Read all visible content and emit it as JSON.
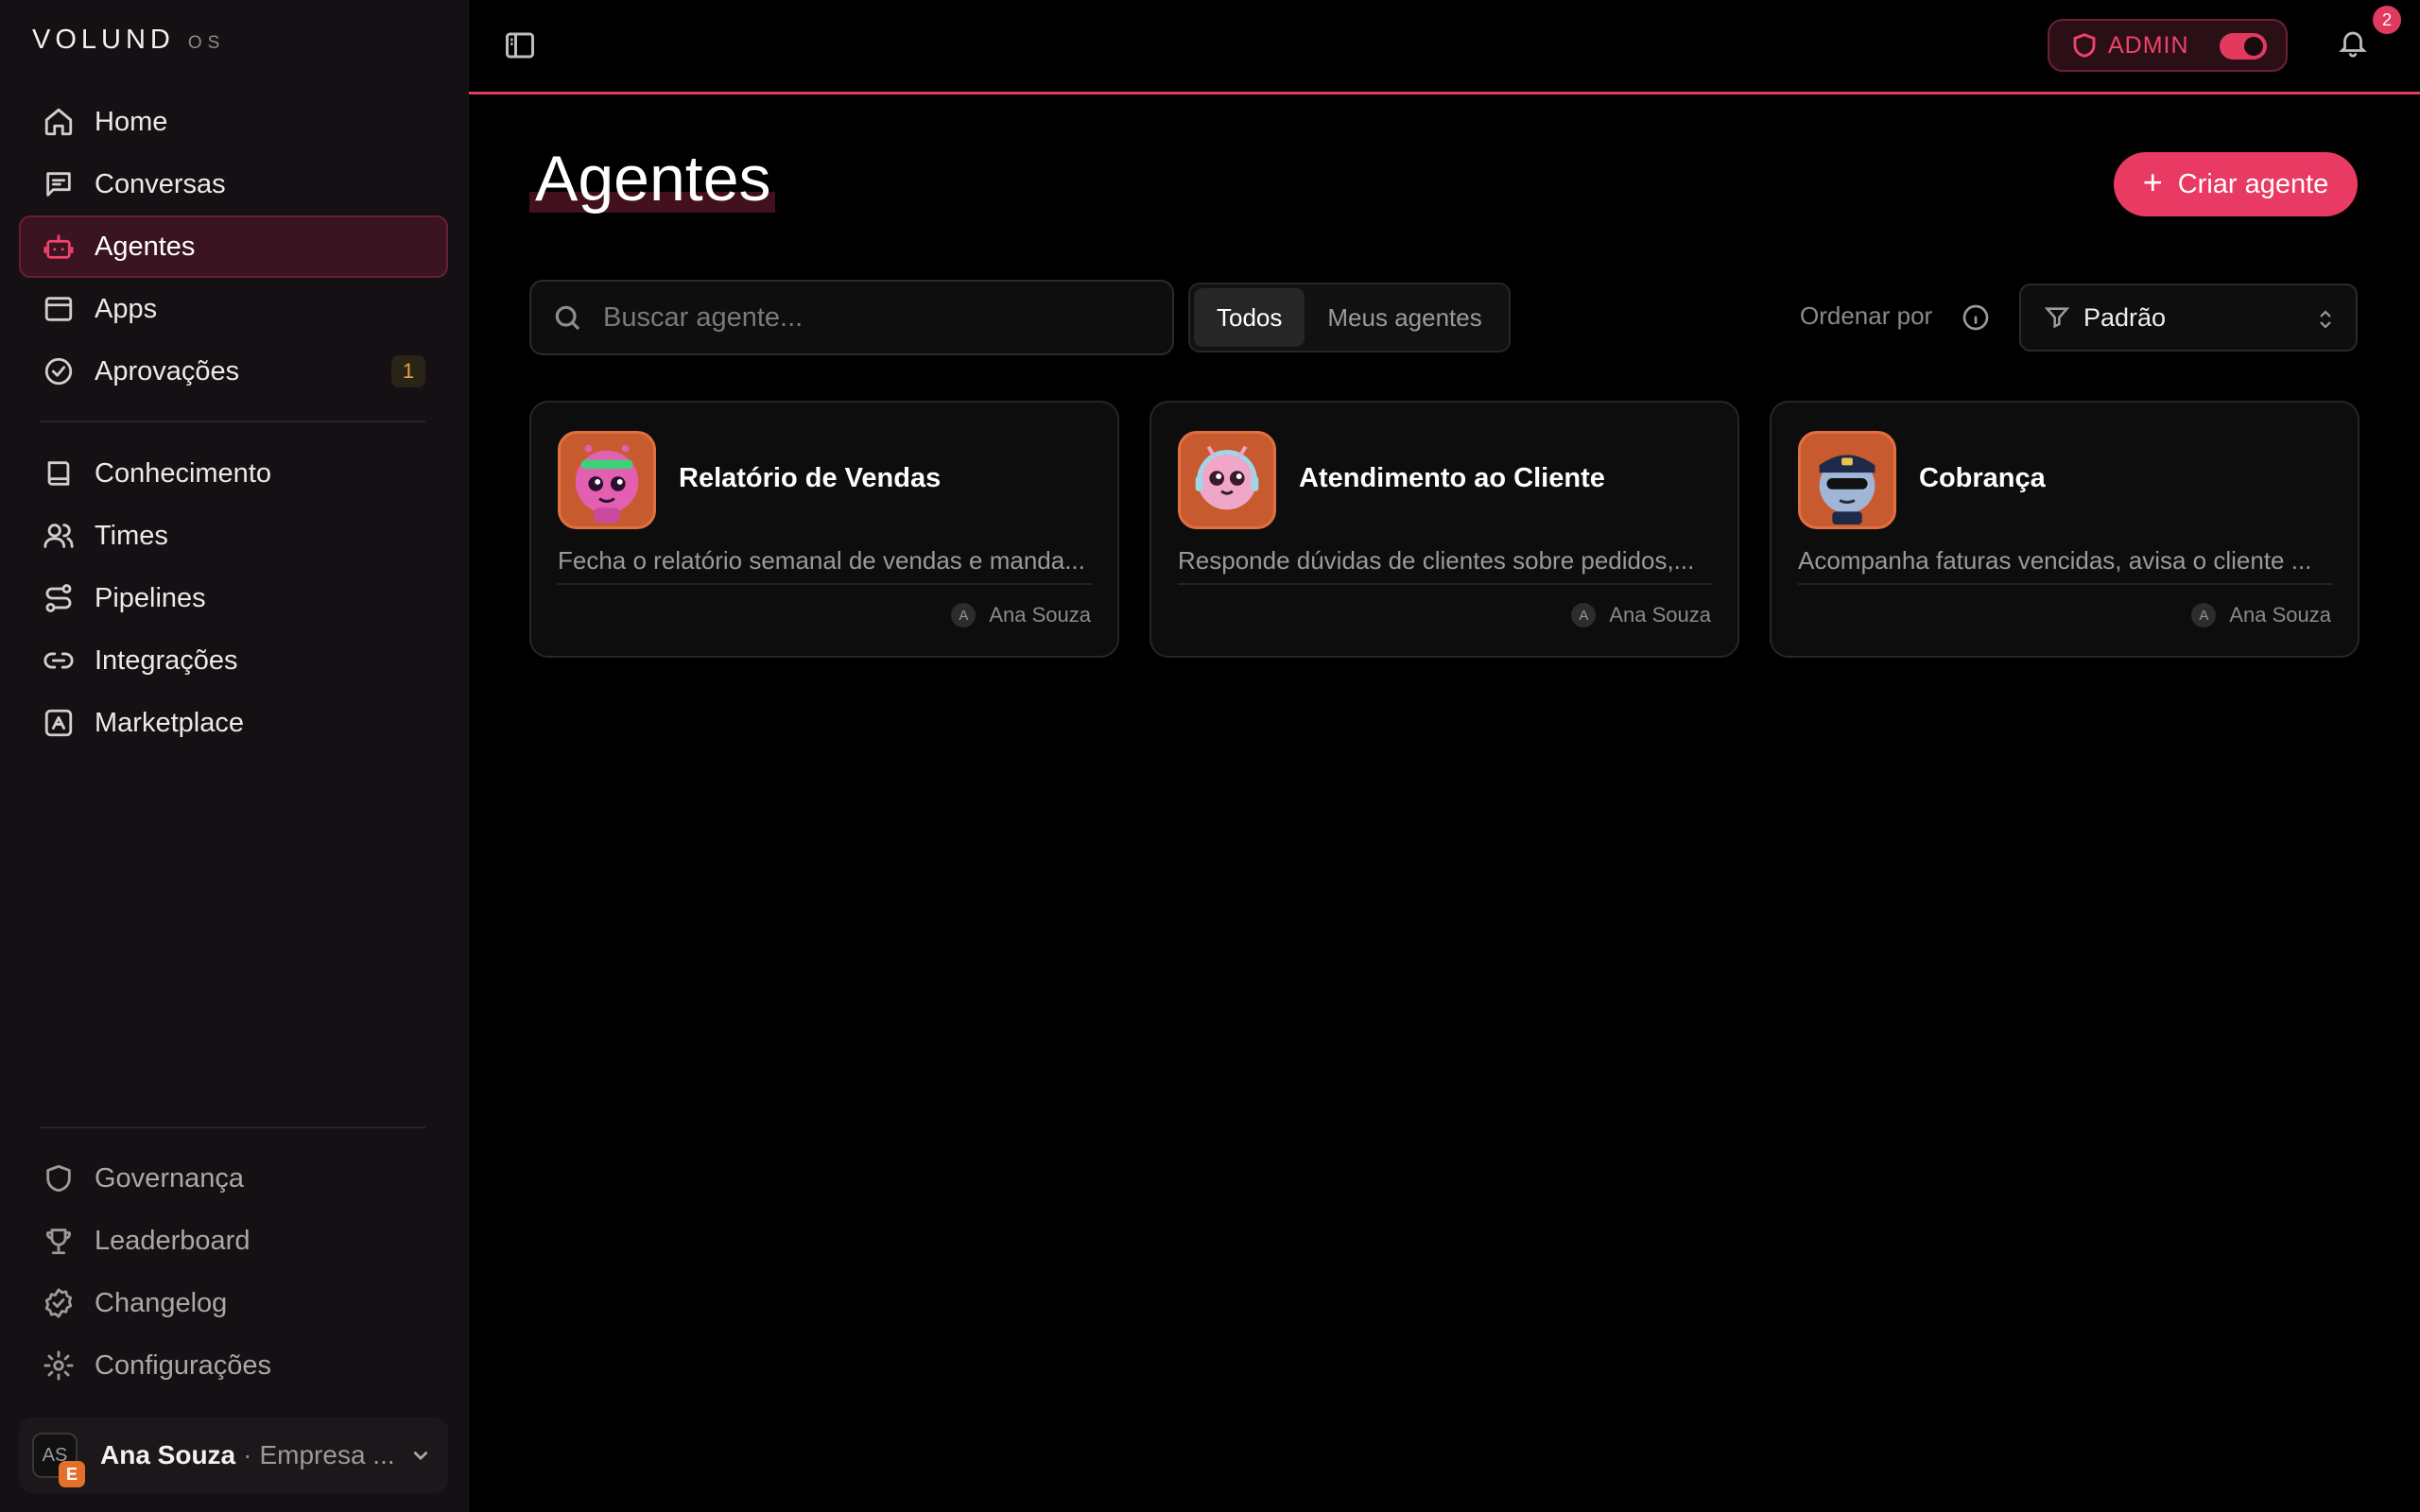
{
  "brand": {
    "name": "VOLUND",
    "suffix": "OS"
  },
  "sidebar": {
    "primary": [
      {
        "label": "Home",
        "icon": "home-icon"
      },
      {
        "label": "Conversas",
        "icon": "message-icon"
      },
      {
        "label": "Agentes",
        "icon": "bot-icon",
        "active": true
      },
      {
        "label": "Apps",
        "icon": "app-window-icon"
      },
      {
        "label": "Aprovações",
        "icon": "check-circle-icon",
        "count": "1"
      }
    ],
    "secondary": [
      {
        "label": "Conhecimento",
        "icon": "book-icon"
      },
      {
        "label": "Times",
        "icon": "users-icon"
      },
      {
        "label": "Pipelines",
        "icon": "route-icon"
      },
      {
        "label": "Integrações",
        "icon": "link-icon"
      },
      {
        "label": "Marketplace",
        "icon": "store-icon"
      }
    ],
    "footer": [
      {
        "label": "Governança",
        "icon": "shield-icon"
      },
      {
        "label": "Leaderboard",
        "icon": "trophy-icon"
      },
      {
        "label": "Changelog",
        "icon": "badge-check-icon"
      },
      {
        "label": "Configurações",
        "icon": "gear-icon"
      }
    ],
    "user": {
      "initials": "AS",
      "org_badge": "E",
      "name": "Ana Souza",
      "separator": "·",
      "company": "Empresa ..."
    }
  },
  "topbar": {
    "admin_label": "ADMIN",
    "notifications_count": "2",
    "accent_color": "#e23a5e"
  },
  "main": {
    "title": "Agentes",
    "create_button": "Criar agente",
    "search_placeholder": "Buscar agente...",
    "filters": [
      "Todos",
      "Meus agentes"
    ],
    "active_filter": "Todos",
    "order_label": "Ordenar por",
    "order_value": "Padrão",
    "agents": [
      {
        "name": "Relatório de Vendas",
        "description": "Fecha o relatório semanal de vendas e manda...",
        "owner": "Ana Souza",
        "owner_initial": "A",
        "avatar": "robot-pink-icon"
      },
      {
        "name": "Atendimento ao Cliente",
        "description": "Responde dúvidas de clientes sobre pedidos,...",
        "owner": "Ana Souza",
        "owner_initial": "A",
        "avatar": "robot-headset-icon"
      },
      {
        "name": "Cobrança",
        "description": "Acompanha faturas vencidas, avisa o cliente ...",
        "owner": "Ana Souza",
        "owner_initial": "A",
        "avatar": "robot-police-icon"
      }
    ]
  }
}
